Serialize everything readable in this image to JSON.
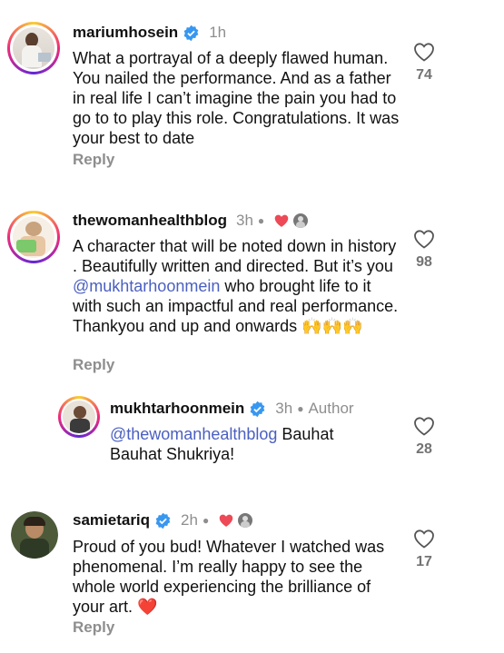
{
  "comments": [
    {
      "username": "mariumhosein",
      "time": "1h",
      "text": "What a portrayal of a deeply flawed human. You nailed the performance. And as a father in real life I can’t imagine the pain you had to go to to play this role. Congratulations. It was your best to date",
      "reply_label": "Reply",
      "likes": "74"
    },
    {
      "username": "thewomanhealthblog",
      "time": "3h",
      "text_before": "A character that will be noted down in history . Beautifully written and directed. But it’s you ",
      "mention": "@mukhtarhoonmein",
      "text_after": " who brought life to it with such an impactful and real performance. Thankyou and up and onwards 🙌🙌🙌",
      "reply_label": "Reply",
      "likes": "98"
    },
    {
      "username": "mukhtarhoonmein",
      "time": "3h",
      "author_label": "Author",
      "mention": "@thewomanhealthblog",
      "text_after": " Bauhat Bauhat Shukriya!",
      "likes": "28"
    },
    {
      "username": "samietariq",
      "time": "2h",
      "text": "Proud of you bud! Whatever I watched was phenomenal. I’m really happy to see the whole world experiencing the brilliance of your art. ❤️",
      "reply_label": "Reply",
      "likes": "17"
    }
  ],
  "colors": {
    "verified": "#3897f0",
    "heart": "#ed4956",
    "mention": "#4a5fc1",
    "muted": "#8e8e8e"
  },
  "icons": {
    "like": "heart-outline-icon",
    "verified": "verified-badge-icon",
    "creator_liked": "red-heart-icon"
  }
}
